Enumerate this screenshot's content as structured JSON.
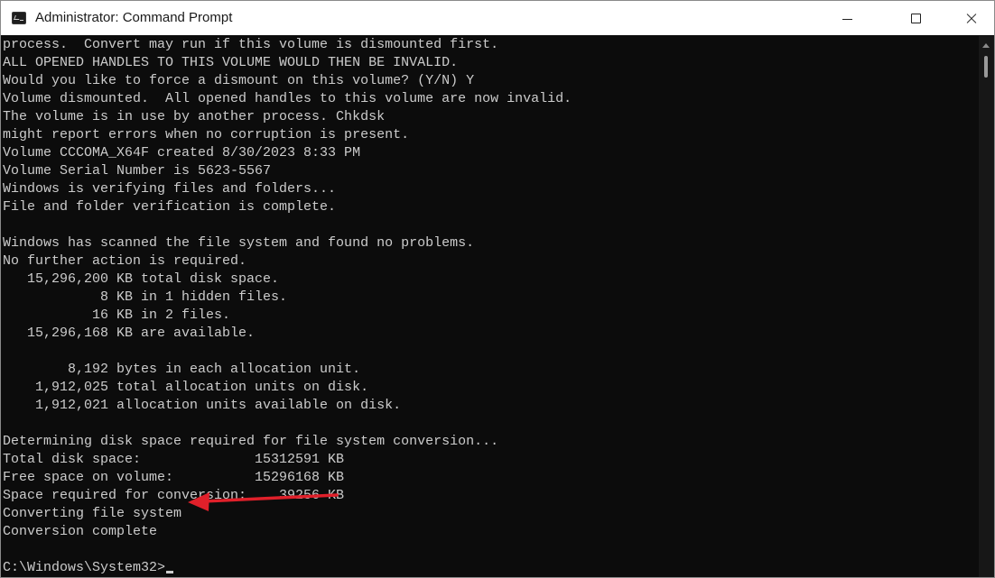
{
  "window": {
    "title": "Administrator: Command Prompt",
    "icon": "command-prompt-icon"
  },
  "controls": {
    "minimize_icon": "minimize-icon",
    "maximize_icon": "maximize-icon",
    "close_icon": "close-icon"
  },
  "console": {
    "lines": [
      "process.  Convert may run if this volume is dismounted first.",
      "ALL OPENED HANDLES TO THIS VOLUME WOULD THEN BE INVALID.",
      "Would you like to force a dismount on this volume? (Y/N) Y",
      "Volume dismounted.  All opened handles to this volume are now invalid.",
      "The volume is in use by another process. Chkdsk",
      "might report errors when no corruption is present.",
      "Volume CCCOMA_X64F created 8/30/2023 8:33 PM",
      "Volume Serial Number is 5623-5567",
      "Windows is verifying files and folders...",
      "File and folder verification is complete.",
      "",
      "Windows has scanned the file system and found no problems.",
      "No further action is required.",
      "   15,296,200 KB total disk space.",
      "            8 KB in 1 hidden files.",
      "           16 KB in 2 files.",
      "   15,296,168 KB are available.",
      "",
      "        8,192 bytes in each allocation unit.",
      "    1,912,025 total allocation units on disk.",
      "    1,912,021 allocation units available on disk.",
      "",
      "Determining disk space required for file system conversion...",
      "Total disk space:              15312591 KB",
      "Free space on volume:          15296168 KB",
      "Space required for conversion:    39256 KB",
      "Converting file system",
      "Conversion complete",
      "",
      "C:\\Windows\\System32>"
    ]
  },
  "colors": {
    "console_background": "#0c0c0c",
    "console_text": "#cccccc",
    "annotation_arrow": "#e0202a"
  }
}
